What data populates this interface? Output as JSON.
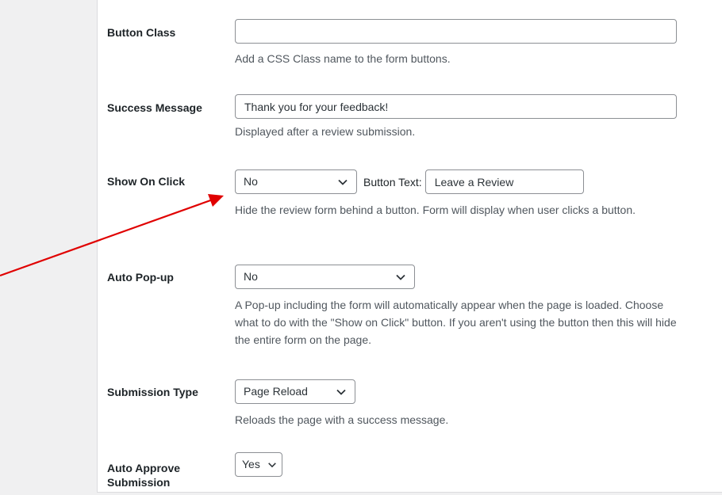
{
  "rows": {
    "button_class": {
      "label": "Button Class",
      "value": "",
      "description": "Add a CSS Class name to the form buttons."
    },
    "success_message": {
      "label": "Success Message",
      "value": "Thank you for your feedback!",
      "description": "Displayed after a review submission."
    },
    "show_on_click": {
      "label": "Show On Click",
      "selected": "No",
      "button_text_label": "Button Text:",
      "button_text_value": "Leave a Review",
      "description": "Hide the review form behind a button. Form will display when user clicks a button."
    },
    "auto_popup": {
      "label": "Auto Pop-up",
      "selected": "No",
      "description": "A Pop-up including the form will automatically appear when the page is loaded. Choose what to do with the \"Show on Click\" button. If you aren't using the button then this will hide the entire form on the page."
    },
    "submission_type": {
      "label": "Submission Type",
      "selected": "Page Reload",
      "description": "Reloads the page with a success message."
    },
    "auto_approve": {
      "label": "Auto Approve Submission",
      "selected": "Yes"
    }
  },
  "colors": {
    "annotation_arrow": "#e00000",
    "page_background": "#f0f0f1",
    "card_background": "#ffffff",
    "input_border": "#8c8f94"
  },
  "icons": {
    "dropdown": "chevron-down-icon"
  }
}
